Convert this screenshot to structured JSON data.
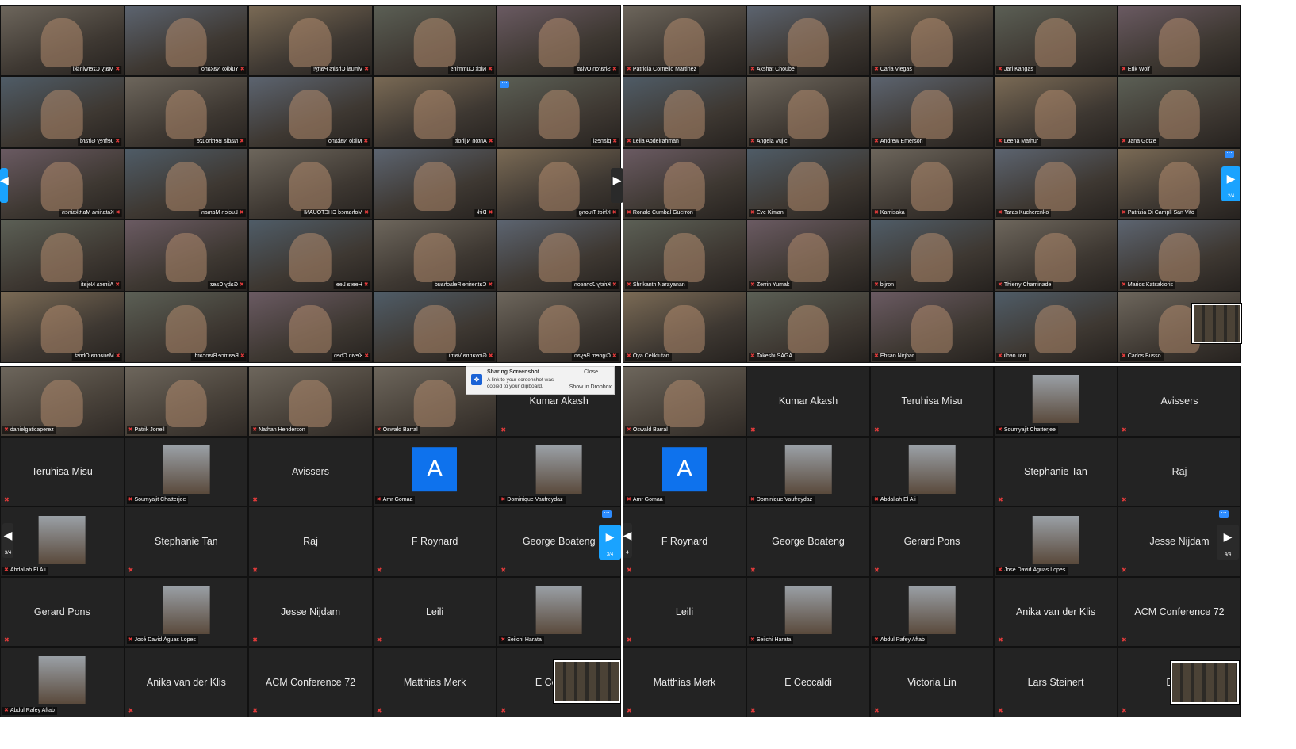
{
  "panels": {
    "top_left": {
      "tiles": [
        [
          "Mary Czerwinski",
          "Yukiko Nakano",
          "Virtual Chairs Party!",
          "Nick Cummins",
          "Sharon Oviatt"
        ],
        [
          "Jeffrey Girard",
          "Nadia Berthouze",
          "Mikio Nakano",
          "Anton Nijholt",
          "pianesi"
        ],
        [
          "Katariina Martikainen",
          "Lucien Maman",
          "Mohamed CHETOUANI",
          "Dirk",
          "Khiet Truong"
        ],
        [
          "Alireza Nejati",
          "Gaby Caez",
          "Heera Lee",
          "Catherine Pelachaud",
          "Kristy Johnson"
        ],
        [
          "Marianna Obrist",
          "Beatrice Biancardi",
          "Kevin Chen",
          "Giovanna Varni",
          "Cigdem Beyan"
        ]
      ]
    },
    "top_right": {
      "tiles": [
        [
          "Patricia Cornelio Martinez",
          "Akshat Choube",
          "Carla Viegas",
          "Jari Kangas",
          "Erik Wolf"
        ],
        [
          "Leila Abdelrahman",
          "Angela Vujic",
          "Andrew Emerson",
          "Leena Mathur",
          "Jana Götze"
        ],
        [
          "Ronald Cumbal Guerron",
          "Eve Kimani",
          "Kamisaka",
          "Taras Kucherenko",
          "Patrizia Di Campli San Vito"
        ],
        [
          "Shrikanth Narayanan",
          "Zerrin Yumak",
          "bijron",
          "Thierry Chaminade",
          "Marios Katsakioris"
        ],
        [
          "Oya Celiktutan",
          "Takeshi SAGA",
          "Ehsan Nirjhar",
          "ilhan lion",
          "Carlos Busso"
        ]
      ],
      "page_indicator": "2/4"
    },
    "bottom_left": {
      "tiles": [
        [
          {
            "kind": "video",
            "label": "danielgaticaperez"
          },
          {
            "kind": "video",
            "label": "Patrik Jonell"
          },
          {
            "kind": "video",
            "label": "Nathan Henderson"
          },
          {
            "kind": "video",
            "label": "Oswald Barral"
          },
          {
            "kind": "name",
            "label": "Kumar Akash"
          }
        ],
        [
          {
            "kind": "name",
            "label": "Teruhisa Misu"
          },
          {
            "kind": "photo",
            "label": "Soumyajit Chatterjee"
          },
          {
            "kind": "name",
            "label": "Avissers"
          },
          {
            "kind": "avatar",
            "label": "Amr Gomaa",
            "letter": "A"
          },
          {
            "kind": "photo",
            "label": "Dominique Vaufreydaz"
          }
        ],
        [
          {
            "kind": "photo",
            "label": "Abdallah El Ali"
          },
          {
            "kind": "name",
            "label": "Stephanie Tan"
          },
          {
            "kind": "name",
            "label": "Raj"
          },
          {
            "kind": "name",
            "label": "F Roynard"
          },
          {
            "kind": "name",
            "label": "George Boateng"
          }
        ],
        [
          {
            "kind": "name",
            "label": "Gerard Pons"
          },
          {
            "kind": "photo",
            "label": "José David Águas Lopes"
          },
          {
            "kind": "name",
            "label": "Jesse Nijdam"
          },
          {
            "kind": "name",
            "label": "Leili"
          },
          {
            "kind": "photo",
            "label": "Seiichi Harata"
          }
        ],
        [
          {
            "kind": "photo",
            "label": "Abdul Rafey Aftab"
          },
          {
            "kind": "name",
            "label": "Anika van der Klis"
          },
          {
            "kind": "name",
            "label": "ACM Conference 72"
          },
          {
            "kind": "name",
            "label": "Matthias Merk"
          },
          {
            "kind": "name",
            "label": "E Ceccaldi"
          }
        ]
      ],
      "left_page": "3/4",
      "right_page": "3/4"
    },
    "bottom_right": {
      "tiles": [
        [
          {
            "kind": "video",
            "label": "Oswald Barral"
          },
          {
            "kind": "name",
            "label": "Kumar Akash"
          },
          {
            "kind": "name",
            "label": "Teruhisa Misu"
          },
          {
            "kind": "photo",
            "label": "Soumyajit Chatterjee"
          },
          {
            "kind": "name",
            "label": "Avissers"
          }
        ],
        [
          {
            "kind": "avatar",
            "label": "Amr Gomaa",
            "letter": "A"
          },
          {
            "kind": "photo",
            "label": "Dominique Vaufreydaz"
          },
          {
            "kind": "photo",
            "label": "Abdallah El Ali"
          },
          {
            "kind": "name",
            "label": "Stephanie Tan"
          },
          {
            "kind": "name",
            "label": "Raj"
          }
        ],
        [
          {
            "kind": "name",
            "label": "F Roynard"
          },
          {
            "kind": "name",
            "label": "George Boateng"
          },
          {
            "kind": "name",
            "label": "Gerard Pons"
          },
          {
            "kind": "photo",
            "label": "José David Águas Lopes"
          },
          {
            "kind": "name",
            "label": "Jesse Nijdam"
          }
        ],
        [
          {
            "kind": "name",
            "label": "Leili"
          },
          {
            "kind": "photo",
            "label": "Seiichi Harata"
          },
          {
            "kind": "photo",
            "label": "Abdul Rafey Aftab"
          },
          {
            "kind": "name",
            "label": "Anika van der Klis"
          },
          {
            "kind": "name",
            "label": "ACM Conference 72"
          }
        ],
        [
          {
            "kind": "name",
            "label": "Matthias Merk"
          },
          {
            "kind": "name",
            "label": "E Ceccaldi"
          },
          {
            "kind": "name",
            "label": "Victoria Lin"
          },
          {
            "kind": "name",
            "label": "Lars Steinert"
          },
          {
            "kind": "name",
            "label": "Bernd"
          }
        ]
      ],
      "left_page": "4",
      "right_page": "4/4"
    }
  },
  "notification": {
    "title": "Sharing Screenshot",
    "message": "A link to your screenshot was copied to your clipboard.",
    "close_label": "Close",
    "action_label": "Show in Dropbox"
  },
  "colors": {
    "accent": "#1aa3ff",
    "mic_muted": "#e23b3b",
    "avatar": "#0e72ed"
  },
  "icons": {
    "mic": "muted-mic-icon",
    "nav": "chevron-right-icon",
    "more": "more-options-icon",
    "dropbox": "dropbox-icon"
  }
}
